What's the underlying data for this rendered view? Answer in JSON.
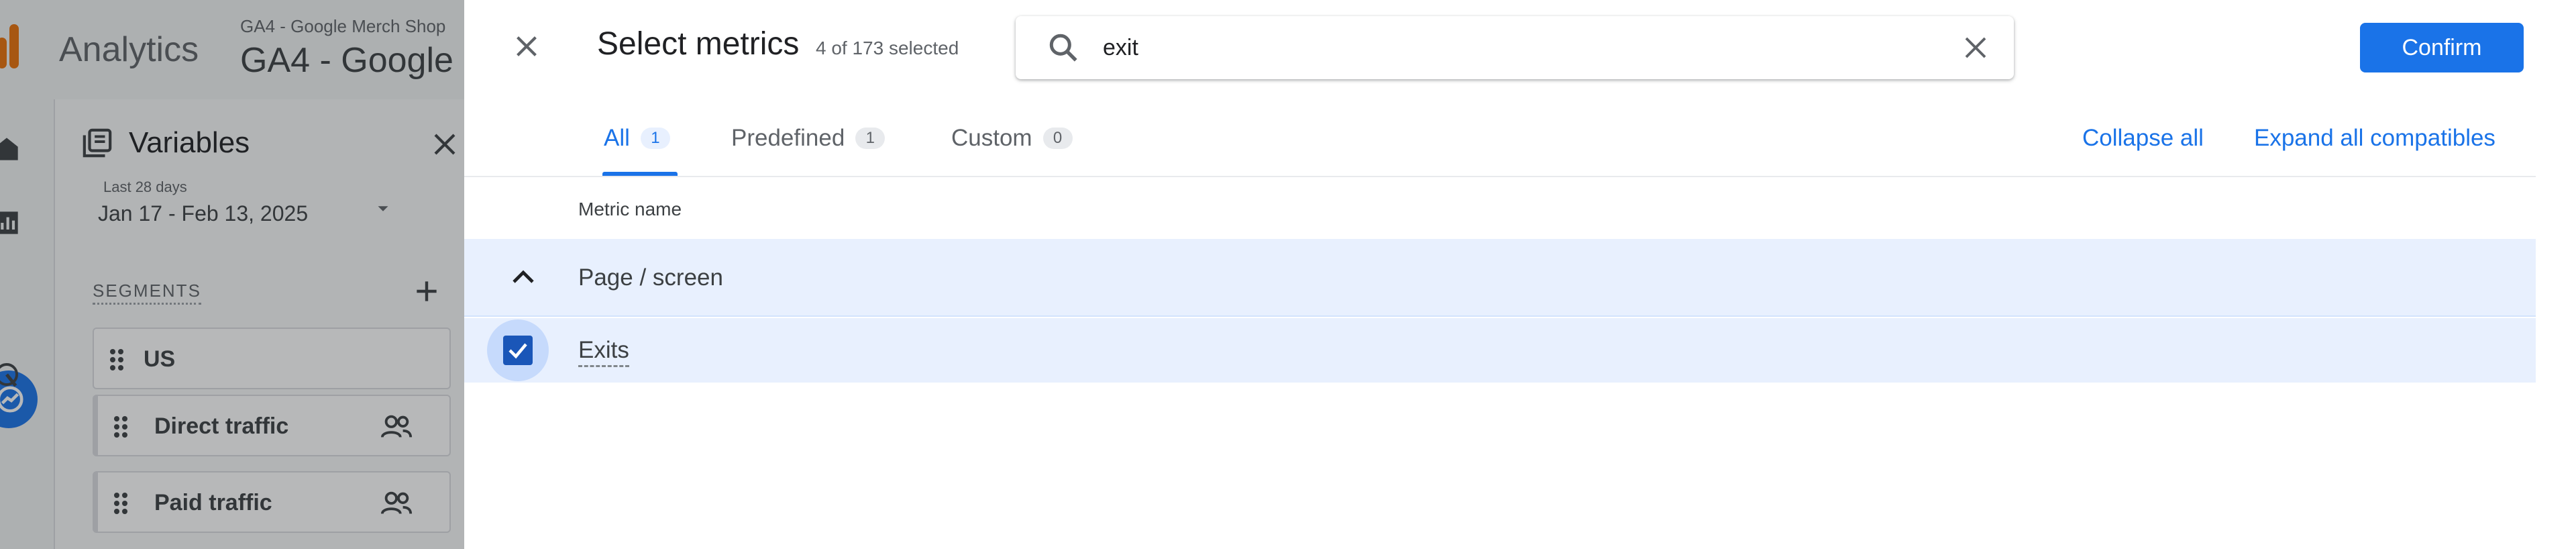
{
  "background_app": {
    "product_name": "Analytics",
    "property_path": "GA4 - Google Merch Shop",
    "property_name": "GA4 - Google",
    "variables_panel": {
      "title": "Variables",
      "date_label": "Last 28 days",
      "date_range": "Jan 17 - Feb 13, 2025",
      "segments_label": "SEGMENTS",
      "segments": [
        {
          "label": "US"
        },
        {
          "label": "Direct traffic"
        },
        {
          "label": "Paid traffic"
        }
      ]
    }
  },
  "dialog": {
    "title": "Select metrics",
    "selected_count": "4 of 173 selected",
    "search": {
      "value": "exit",
      "placeholder": ""
    },
    "confirm_label": "Confirm",
    "tabs": [
      {
        "label": "All",
        "count": "1",
        "active": true
      },
      {
        "label": "Predefined",
        "count": "1",
        "active": false
      },
      {
        "label": "Custom",
        "count": "0",
        "active": false
      }
    ],
    "collapse_all_label": "Collapse all",
    "expand_all_label": "Expand all compatibles",
    "column_header": "Metric name",
    "groups": [
      {
        "label": "Page / screen",
        "expanded": true,
        "metrics": [
          {
            "name": "Exits",
            "checked": true
          }
        ]
      }
    ]
  },
  "colors": {
    "accent": "#1a73e8",
    "selected_row_bg": "#e8f0fe",
    "checkbox_fill": "#1a56b8",
    "logo_orange": "#e8710a"
  },
  "icons": [
    "close-icon",
    "search-icon",
    "clear-search-icon",
    "chevron-up-icon",
    "checkbox-checked-icon",
    "home-icon",
    "reports-icon",
    "explore-icon",
    "advertising-icon",
    "variables-icon",
    "drag-handle-icon",
    "people-icon",
    "plus-icon",
    "dropdown-arrow-icon"
  ]
}
